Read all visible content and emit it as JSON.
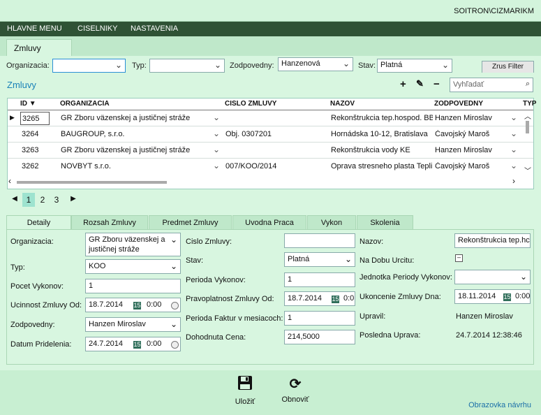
{
  "header": {
    "user": "SOITRON\\CIZMARIKM"
  },
  "menu": [
    "HLAVNE MENU",
    "CISELNIKY",
    "NASTAVENIA"
  ],
  "page_tab": "Zmluvy",
  "filters": {
    "organizacia_label": "Organizacia:",
    "organizacia_value": "",
    "typ_label": "Typ:",
    "typ_value": "",
    "zodpovedny_label": "Zodpovedny:",
    "zodpovedny_value": "Hanzenová",
    "stav_label": "Stav:",
    "stav_value": "Platná",
    "button": "Zrus Filter"
  },
  "grid": {
    "title": "Zmluvy",
    "search_placeholder": "Vyhľadať",
    "columns": {
      "id": "ID",
      "org": "ORGANIZACIA",
      "cislo": "CISLO ZMLUVY",
      "nazov": "NAZOV",
      "zodp": "ZODPOVEDNY",
      "typ": "TYP"
    },
    "rows": [
      {
        "id": "3265",
        "org": "GR Zboru väzenskej a justičnej stráže",
        "cislo": "",
        "nazov": "Rekonštrukcia tep.hospod. BB",
        "zodp": "Hanzen Miroslav"
      },
      {
        "id": "3264",
        "org": "BAUGROUP, s.r.o.",
        "cislo": "Obj. 0307201",
        "nazov": "Hornádska 10-12, Bratislava",
        "zodp": "Čavojský Maroš"
      },
      {
        "id": "3263",
        "org": "GR Zboru väzenskej a justičnej stráže",
        "cislo": "",
        "nazov": "Rekonštrukcia vody KE",
        "zodp": "Hanzen Miroslav"
      },
      {
        "id": "3262",
        "org": "NOVBYT s.r.o.",
        "cislo": "007/KOO/2014",
        "nazov": "Oprava stresneho plasta Tepli",
        "zodp": "Čavojský Maroš"
      }
    ]
  },
  "pager": {
    "pages": [
      "1",
      "2",
      "3"
    ],
    "current": "1"
  },
  "detail_tabs": [
    "Detaily",
    "Rozsah Zmluvy",
    "Predmet Zmluvy",
    "Uvodna Praca",
    "Vykon",
    "Skolenia"
  ],
  "detail": {
    "organizacia_label": "Organizacia:",
    "organizacia_value": "GR Zboru väzenskej a justičnej stráže",
    "typ_label": "Typ:",
    "typ_value": "KOO",
    "pocet_label": "Pocet Vykonov:",
    "pocet_value": "1",
    "ucinnost_label": "Ucinnost Zmluvy Od:",
    "ucinnost_date": "18.7.2014",
    "ucinnost_time": "0:00",
    "zodpovedny_label": "Zodpovedny:",
    "zodpovedny_value": "Hanzen Miroslav",
    "pridelenia_label": "Datum Pridelenia:",
    "pridelenia_date": "24.7.2014",
    "pridelenia_time": "0:00",
    "cislo_label": "Cislo Zmluvy:",
    "cislo_value": "",
    "stav_label": "Stav:",
    "stav_value": "Platná",
    "perioda_label": "Perioda Vykonov:",
    "perioda_value": "1",
    "pravoplatnost_label": "Pravoplatnost Zmluvy Od:",
    "pravoplatnost_date": "18.7.2014",
    "pravoplatnost_time": "0:0",
    "faktur_label": "Perioda Faktur v mesiacoch:",
    "faktur_value": "1",
    "cena_label": "Dohodnuta Cena:",
    "cena_value": "214,5000",
    "nazov_label": "Nazov:",
    "nazov_value": "Rekonštrukcia tep.hc",
    "dobu_label": "Na Dobu Urcitu:",
    "jednotka_label": "Jednotka Periody Vykonov:",
    "jednotka_value": "",
    "ukoncenie_label": "Ukoncenie Zmluvy Dna:",
    "ukoncenie_date": "18.11.2014",
    "ukoncenie_time": "0:00",
    "upravil_label": "Upravil:",
    "upravil_value": "Hanzen Miroslav",
    "uprava_label": "Posledna Uprava:",
    "uprava_value": "24.7.2014 12:38:46"
  },
  "footer": {
    "save": "Uložiť",
    "refresh": "Obnoviť",
    "designer": "Obrazovka návrhu"
  },
  "colors": {
    "menu_bg": "#2f5235",
    "panel_bg": "#d8f6e0",
    "accent_link": "#1a82b8"
  }
}
